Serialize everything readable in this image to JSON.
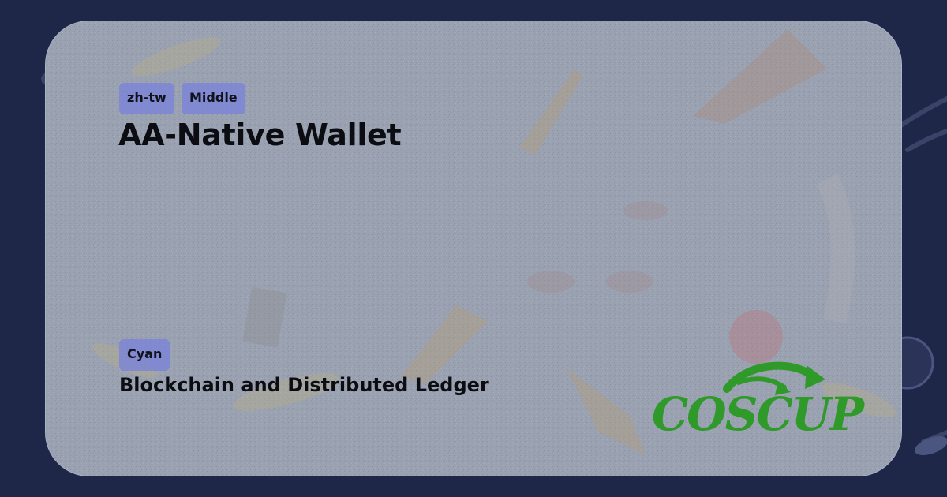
{
  "card": {
    "tags": {
      "language": "zh-tw",
      "level": "Middle"
    },
    "title": "AA-Native Wallet",
    "track": {
      "tag": "Cyan",
      "name": "Blockchain and Distributed Ledger"
    }
  },
  "logo": {
    "text": "COSCUP",
    "icon": "coscup-arrow-logo"
  },
  "colors": {
    "background": "#1e2748",
    "card": "#9aa1b0",
    "tag": "#7d86d6",
    "logo_green": "#2f9a2a",
    "text": "#0c0d12"
  }
}
